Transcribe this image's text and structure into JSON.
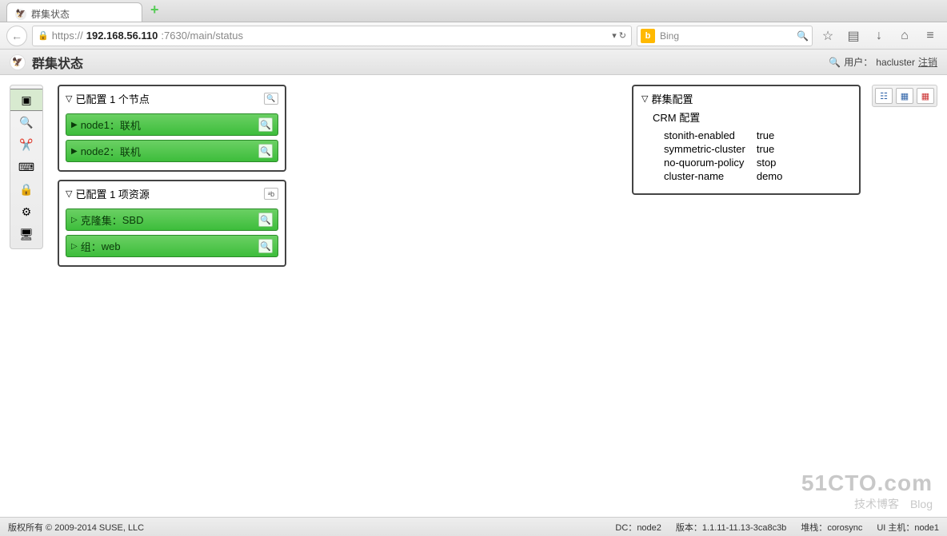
{
  "browser": {
    "tab_title": "群集状态",
    "url_scheme": "https://",
    "url_host": "192.168.56.110",
    "url_port_path": ":7630/main/status",
    "search_placeholder": "Bing"
  },
  "app": {
    "title": "群集状态",
    "user_label": "用户：",
    "user_name": "hacluster",
    "logout": "注销"
  },
  "nodes_panel": {
    "title": "已配置 1 个节点",
    "items": [
      {
        "name": "node1",
        "status": "联机"
      },
      {
        "name": "node2",
        "status": "联机"
      }
    ]
  },
  "resources_panel": {
    "title": "已配置 1 项资源",
    "items": [
      {
        "kind": "克隆集",
        "name": "SBD"
      },
      {
        "kind": "组",
        "name": "web"
      }
    ]
  },
  "config_panel": {
    "title": "群集配置",
    "crm_label": "CRM 配置",
    "rows": [
      {
        "k": "stonith-enabled",
        "v": "true"
      },
      {
        "k": "symmetric-cluster",
        "v": "true"
      },
      {
        "k": "no-quorum-policy",
        "v": "stop"
      },
      {
        "k": "cluster-name",
        "v": "demo"
      }
    ]
  },
  "footer": {
    "copyright": "版权所有 © 2009-2014 SUSE, LLC",
    "dc_label": "DC：",
    "dc_value": "node2",
    "ver_label": "版本：",
    "ver_value": "1.1.11-11.13-3ca8c3b",
    "stack_label": "堆栈：",
    "stack_value": "corosync",
    "host_label": "UI 主机：",
    "host_value": "node1"
  },
  "watermark": {
    "line1": "51CTO.com",
    "line2": "技术博客　Blog"
  }
}
